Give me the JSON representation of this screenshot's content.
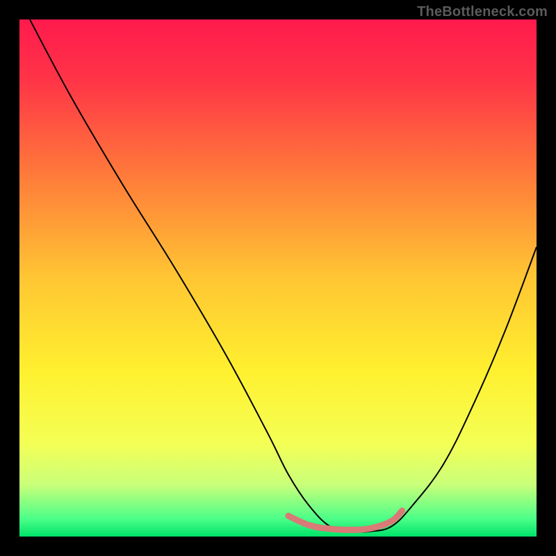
{
  "watermark": "TheBottleneck.com",
  "chart_data": {
    "type": "line",
    "title": "",
    "xlabel": "",
    "ylabel": "",
    "xlim": [
      0,
      100
    ],
    "ylim": [
      0,
      100
    ],
    "grid": false,
    "legend": false,
    "background_gradient_stops": [
      {
        "pos": 0.0,
        "color": "#ff1a4d"
      },
      {
        "pos": 0.12,
        "color": "#ff3547"
      },
      {
        "pos": 0.3,
        "color": "#ff7a3a"
      },
      {
        "pos": 0.5,
        "color": "#ffc633"
      },
      {
        "pos": 0.68,
        "color": "#fff02f"
      },
      {
        "pos": 0.82,
        "color": "#f4ff55"
      },
      {
        "pos": 0.9,
        "color": "#c9ff7a"
      },
      {
        "pos": 0.965,
        "color": "#4dff88"
      },
      {
        "pos": 1.0,
        "color": "#00e36b"
      }
    ],
    "series": [
      {
        "name": "bottleneck-curve",
        "color": "#000000",
        "x": [
          2,
          10,
          20,
          30,
          40,
          48,
          52,
          56,
          60,
          64,
          68,
          72,
          76,
          82,
          88,
          94,
          100
        ],
        "y": [
          100,
          85,
          68,
          52,
          35,
          20,
          12,
          6,
          2,
          1,
          1,
          2,
          6,
          14,
          26,
          40,
          56
        ]
      }
    ],
    "annotations": [
      {
        "name": "trough-marker",
        "color": "#d97a77",
        "x": [
          52,
          56,
          60,
          64,
          68,
          72,
          74
        ],
        "y": [
          4.0,
          2.2,
          1.5,
          1.3,
          1.6,
          3.0,
          5.0
        ]
      }
    ]
  }
}
